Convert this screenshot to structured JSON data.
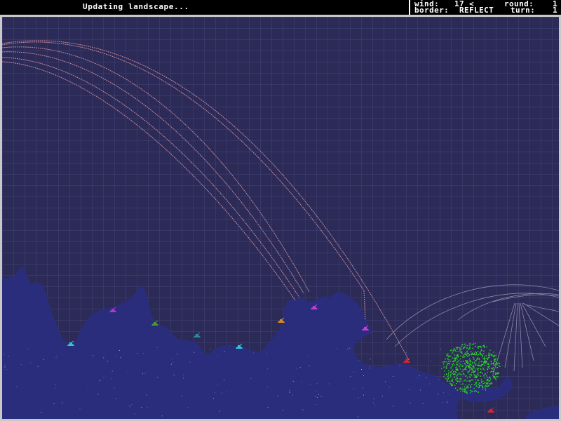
{
  "status": {
    "message": "Updating landscape..."
  },
  "hud": {
    "wind_label": "wind:",
    "wind_value": "17 <",
    "round_label": "round:",
    "round_value": "1",
    "border_label": "border:",
    "border_value": "REFLECT",
    "turn_label": "turn:",
    "turn_value": "1"
  },
  "colors": {
    "sky": "#2c2b58",
    "terrain": "#2a2d7c",
    "trajectory": "#c48a9a",
    "arc": "#8c88a4",
    "explosion": "#2bd82b",
    "frame": "#c8c8c8"
  },
  "tanks": [
    {
      "name": "tank-cyan-1",
      "color": "#33c4d6"
    },
    {
      "name": "tank-magenta-1",
      "color": "#b634c8"
    },
    {
      "name": "tank-green",
      "color": "#4f9a2a"
    },
    {
      "name": "tank-teal",
      "color": "#2a8aa0"
    },
    {
      "name": "tank-cyan-2",
      "color": "#33c4d6"
    },
    {
      "name": "tank-orange",
      "color": "#d88a22"
    },
    {
      "name": "tank-magenta-2",
      "color": "#c23ed8"
    },
    {
      "name": "tank-magenta-3",
      "color": "#c23ed8"
    },
    {
      "name": "tank-red-1",
      "color": "#e0202a"
    },
    {
      "name": "tank-red-2",
      "color": "#e0202a"
    }
  ]
}
